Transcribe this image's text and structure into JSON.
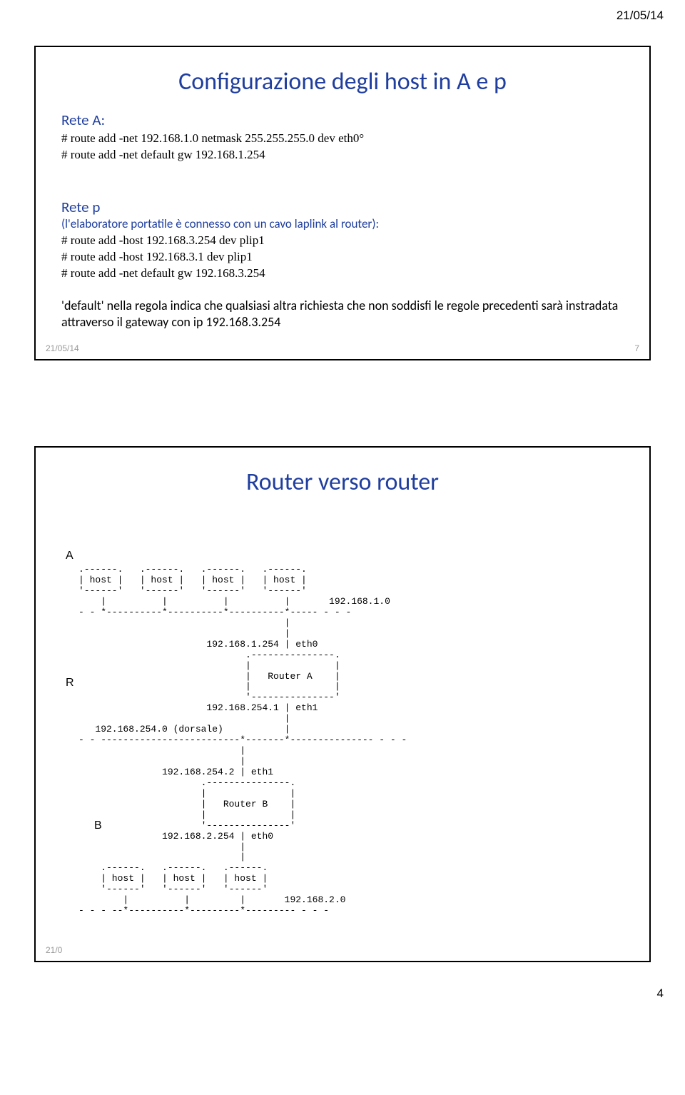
{
  "header_date": "21/05/14",
  "page_number": "4",
  "slide1": {
    "title": "Configurazione degli host in A e p",
    "reteA_label": "Rete A:",
    "reteA_line1": "# route add -net 192.168.1.0 netmask 255.255.255.0 dev eth0°",
    "reteA_line2": "# route add -net default gw 192.168.1.254",
    "reteP_label": "Rete p",
    "reteP_sub": "(l'elaboratore portatile è connesso con un cavo laplink al router):",
    "reteP_line1": "# route add -host 192.168.3.254 dev plip1",
    "reteP_line2": "# route add -host 192.168.3.1 dev plip1",
    "reteP_line3": "# route add -net default gw 192.168.3.254",
    "note": "'default' nella regola indica che qualsiasi altra richiesta che non soddisfi le regole precedenti sarà instradata attraverso il gateway con ip 192.168.3.254",
    "footer_date": "21/05/14",
    "footer_num": "7"
  },
  "slide2": {
    "title": "Router verso router",
    "marker_A": "A",
    "marker_R": "R",
    "marker_B": "B",
    "footer_date": "21/0",
    "ascii": ".------.   .------.   .------.   .------.\n| host |   | host |   | host |   | host |\n'------'   '------'   '------'   '------'\n    |          |          |          |       192.168.1.0\n- - *----------*----------*----------*----- - - -\n                                     |\n                                     |\n                       192.168.1.254 | eth0\n                              .---------------.\n                              |               |\n                              |   Router A    |\n                              |               |\n                              '---------------'\n                       192.168.254.1 | eth1\n                                     |\n   192.168.254.0 (dorsale)           |\n- - -------------------------*-------*--------------- - - -\n                             |\n                             |\n               192.168.254.2 | eth1\n                      .---------------.\n                      |               |\n                      |   Router B    |\n                      |               |\n                      '---------------'\n               192.168.2.254 | eth0\n                             |\n                             |\n    .------.   .------.   .------.\n    | host |   | host |   | host |\n    '------'   '------'   '------'\n        |          |         |       192.168.2.0\n- - - --*----------*---------*--------- - - -"
  }
}
